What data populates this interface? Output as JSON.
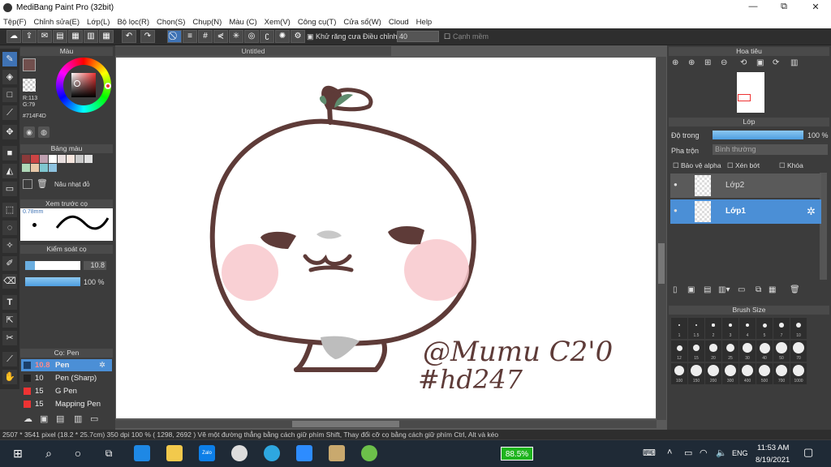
{
  "window": {
    "title": "MediBang Paint Pro (32bit)",
    "min": "—",
    "max": "⧉",
    "close": "✕"
  },
  "menu": [
    "Tệp(F)",
    "Chỉnh sửa(E)",
    "Lớp(L)",
    "Bộ lọc(R)",
    "Chọn(S)",
    "Chụp(N)",
    "Màu (C)",
    "Xem(V)",
    "Công cụ(T)",
    "Cửa sổ(W)",
    "Cloud",
    "Help"
  ],
  "toolbar": {
    "antialias": "Khử răng cưa",
    "adjust_label": "Điều chỉnh",
    "adjust_value": "40",
    "edge": "Cạnh mềm"
  },
  "color_panel": {
    "title": "Màu",
    "r": "R:113",
    "g": "G:79",
    "hex": "#714F4D",
    "main_color": "#714f4d"
  },
  "palette_panel": {
    "title": "Bảng màu",
    "selected_name": "Nâu nhạt đỏ",
    "swatches": [
      "#8b3a3a",
      "#c44",
      "#bfa0b0",
      "#fff",
      "#e8dede",
      "#f5e5dd",
      "#c9c9c9",
      "#e0e0e0",
      "#b0d8b8",
      "#e8c8a8",
      "#7fc7d0",
      "#8ec3e0"
    ]
  },
  "preview_panel": {
    "title": "Xem trước cọ",
    "size": "0.78mm"
  },
  "brush_control": {
    "title": "Kiểm soát cọ",
    "size": "10.8",
    "opacity": "100 %"
  },
  "brush_panel": {
    "title": "Cọ: Pen",
    "items": [
      {
        "size": "10.8",
        "name": "Pen",
        "color": "#1b3f6a",
        "selected": true
      },
      {
        "size": "10",
        "name": "Pen (Sharp)",
        "color": "#222"
      },
      {
        "size": "15",
        "name": "G Pen",
        "color": "#e33"
      },
      {
        "size": "15",
        "name": "Mapping Pen",
        "color": "#e33"
      }
    ]
  },
  "document": {
    "title": "Untitled",
    "signature_line1": "@Mumu C2'0",
    "signature_line2": "#hd247"
  },
  "navigator": {
    "title": "Hoa tiêu"
  },
  "layer_panel": {
    "title": "Lớp",
    "opacity_label": "Độ trong",
    "opacity_value": "100 %",
    "blend_label": "Pha trộn",
    "blend_value": "Bình thường",
    "protect_alpha": "Bảo vệ alpha",
    "clip": "Xén bớt",
    "lock": "Khóa",
    "layers": [
      {
        "name": "Lớp2",
        "selected": false
      },
      {
        "name": "Lớp1",
        "selected": true
      }
    ]
  },
  "brush_size_panel": {
    "title": "Brush Size",
    "sizes_row1": [
      "1",
      "1.5",
      "2",
      "3",
      "4",
      "5",
      "7",
      "10"
    ],
    "sizes_row2": [
      "12",
      "15",
      "20",
      "25",
      "30",
      "40",
      "50",
      "70"
    ],
    "sizes_row3": [
      "100",
      "150",
      "200",
      "300",
      "400",
      "500",
      "700",
      "1000"
    ]
  },
  "status": {
    "text": "2507 * 3541 pixel   (18.2 * 25.7cm)   350 dpi   100 %   ( 1298, 2692 )   Vẽ một đường thẳng bằng cách giữ phím Shift, Thay đổi cỡ cọ bằng cách giữ phím Ctrl, Alt và kéo"
  },
  "taskbar": {
    "battery": "88.5%",
    "lang": "ENG",
    "time": "11:53 AM",
    "date": "8/19/2021",
    "zalo": "Zalo"
  }
}
